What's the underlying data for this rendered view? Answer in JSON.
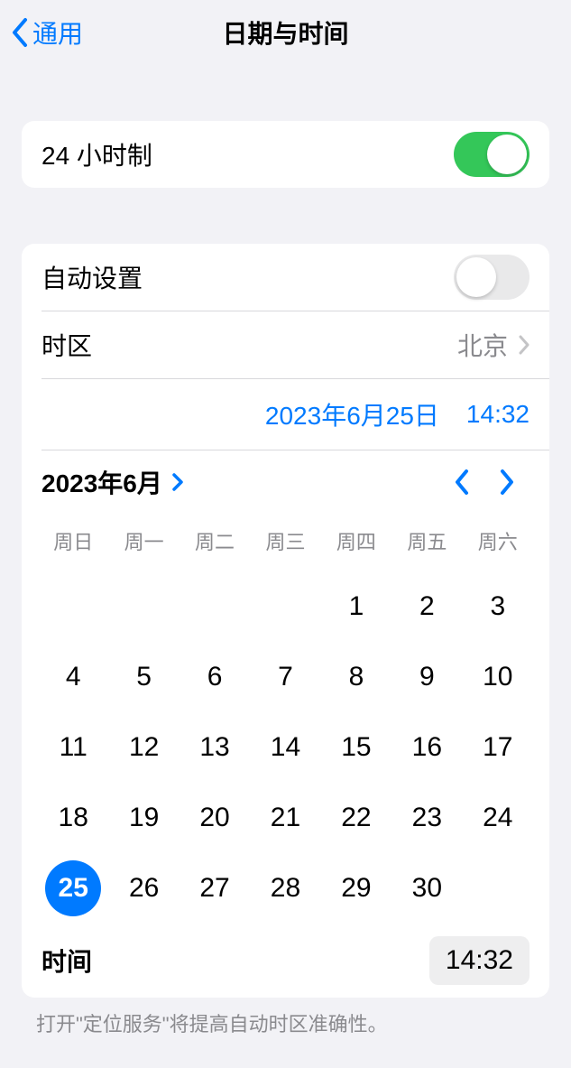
{
  "nav": {
    "back_label": "通用",
    "title": "日期与时间"
  },
  "row24h": {
    "label": "24 小时制",
    "on": true
  },
  "auto_set": {
    "label": "自动设置",
    "on": false
  },
  "tz": {
    "label": "时区",
    "value": "北京"
  },
  "dt": {
    "date_label": "2023年6月25日",
    "time_label": "14:32"
  },
  "cal": {
    "month_label": "2023年6月",
    "weekdays": [
      "周日",
      "周一",
      "周二",
      "周三",
      "周四",
      "周五",
      "周六"
    ],
    "lead_blanks": 4,
    "days": 30,
    "selected": 25
  },
  "time_row": {
    "label": "时间",
    "value": "14:32"
  },
  "hint": "打开\"定位服务\"将提高自动时区准确性。"
}
